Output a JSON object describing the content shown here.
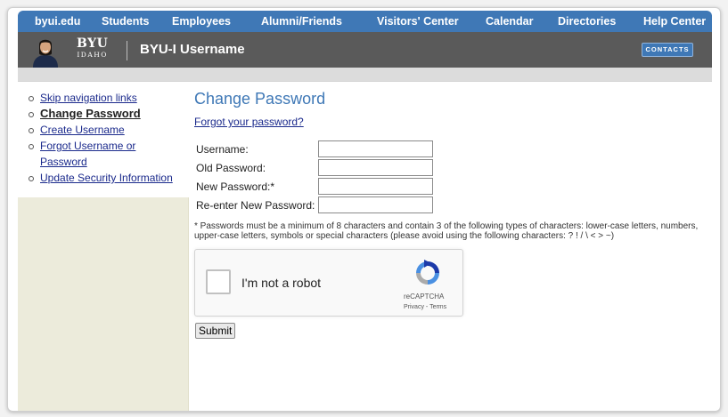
{
  "topnav": {
    "items": [
      "byui.edu",
      "Students",
      "Employees",
      "Alumni/Friends",
      "Visitors' Center",
      "Calendar",
      "Directories",
      "Help Center"
    ]
  },
  "banner": {
    "logo_line1": "BYU",
    "logo_line2": "IDAHO",
    "title": "BYU-I Username",
    "contacts_label": "CONTACTS"
  },
  "sidebar": {
    "items": [
      {
        "label": "Skip navigation links",
        "current": false
      },
      {
        "label": "Change Password",
        "current": true
      },
      {
        "label": "Create Username",
        "current": false
      },
      {
        "label": "Forgot Username or Password",
        "current": false
      },
      {
        "label": "Update Security Information",
        "current": false
      }
    ]
  },
  "main": {
    "title": "Change Password",
    "forgot_link": "Forgot your password?",
    "fields": [
      {
        "label": "Username:",
        "value": ""
      },
      {
        "label": "Old Password:",
        "value": ""
      },
      {
        "label": "New Password:*",
        "value": ""
      },
      {
        "label": "Re-enter New Password:",
        "value": ""
      }
    ],
    "note": "* Passwords must be a minimum of 8 characters and contain 3 of the following types of characters: lower-case letters, numbers, upper-case letters, symbols or special characters (please avoid using the following characters: ? ! / \\ < > ~)",
    "recaptcha": {
      "checkbox_label": "I'm not a robot",
      "brand": "reCAPTCHA",
      "privacy": "Privacy",
      "terms": "Terms",
      "icon": "recaptcha-logo-icon"
    },
    "submit_label": "Submit"
  },
  "colors": {
    "nav_blue": "#3f78b6",
    "banner_gray": "#5a5a5a",
    "sidebar_beige": "#ecebdb",
    "title_blue": "#3f78b6",
    "link_blue": "#1b2a8c"
  }
}
